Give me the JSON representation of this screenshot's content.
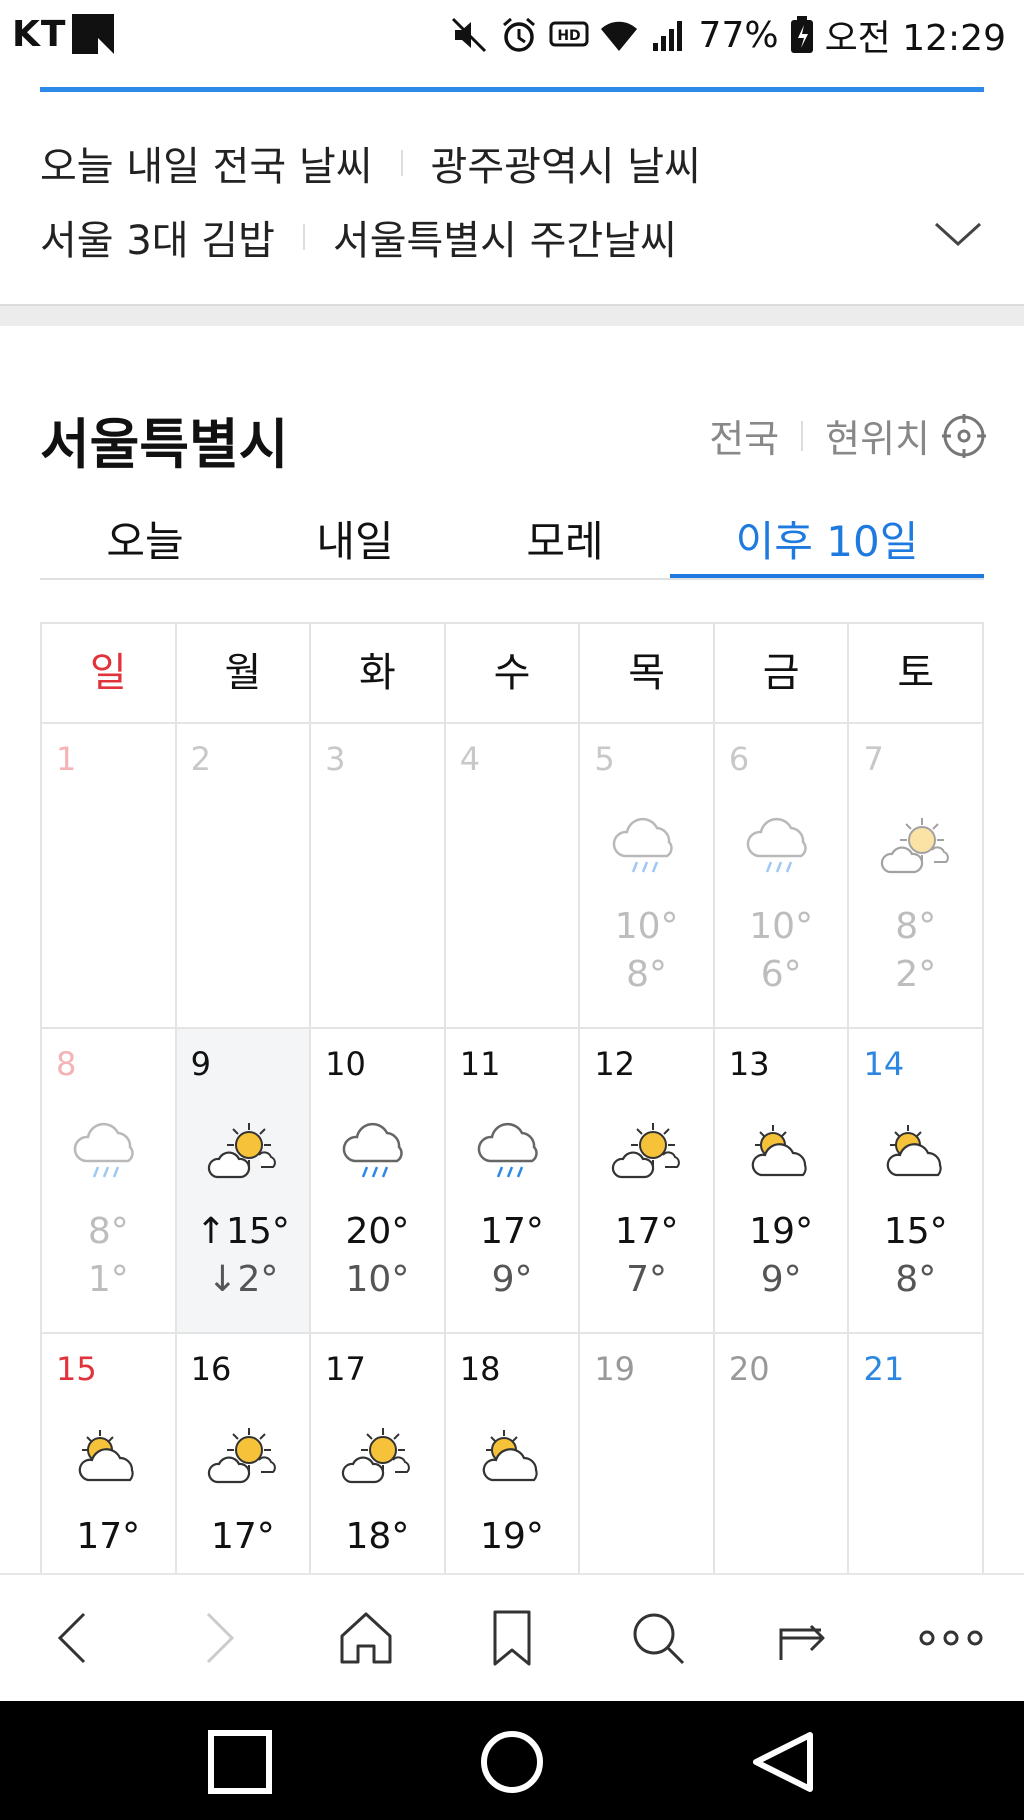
{
  "status_bar": {
    "carrier": "KT",
    "battery": "77%",
    "time": "오전 12:29"
  },
  "related_searches": {
    "row1": [
      "오늘 내일 전국 날씨",
      "광주광역시 날씨"
    ],
    "row2": [
      "서울 3대 김밥",
      "서울특별시 주간날씨"
    ]
  },
  "weather": {
    "city": "서울특별시",
    "links": {
      "nation": "전국",
      "current_location": "현위치"
    },
    "tabs": [
      "오늘",
      "내일",
      "모레",
      "이후 10일"
    ],
    "active_tab": "이후 10일",
    "weekdays": [
      "일",
      "월",
      "화",
      "수",
      "목",
      "금",
      "토"
    ],
    "weeks": [
      [
        {
          "day": "1"
        },
        {
          "day": "2"
        },
        {
          "day": "3"
        },
        {
          "day": "4"
        },
        {
          "day": "5",
          "icon": "rain-cloud-icon",
          "hi": "10°",
          "lo": "8°"
        },
        {
          "day": "6",
          "icon": "rain-cloud-icon",
          "hi": "10°",
          "lo": "6°"
        },
        {
          "day": "7",
          "icon": "sun-behind-cloud-icon",
          "hi": "8°",
          "lo": "2°"
        }
      ],
      [
        {
          "day": "8",
          "icon": "rain-cloud-icon",
          "hi": "8°",
          "lo": "1°"
        },
        {
          "day": "9",
          "icon": "sun-behind-cloud-icon",
          "hi": "↑15°",
          "lo": "↓2°"
        },
        {
          "day": "10",
          "icon": "rain-cloud-icon",
          "hi": "20°",
          "lo": "10°"
        },
        {
          "day": "11",
          "icon": "rain-cloud-icon",
          "hi": "17°",
          "lo": "9°"
        },
        {
          "day": "12",
          "icon": "sun-behind-cloud-icon",
          "hi": "17°",
          "lo": "7°"
        },
        {
          "day": "13",
          "icon": "partly-cloudy-icon",
          "hi": "19°",
          "lo": "9°"
        },
        {
          "day": "14",
          "icon": "partly-cloudy-icon",
          "hi": "15°",
          "lo": "8°"
        }
      ],
      [
        {
          "day": "15",
          "icon": "partly-cloudy-icon",
          "hi": "17°",
          "lo": ""
        },
        {
          "day": "16",
          "icon": "sun-behind-cloud-icon",
          "hi": "17°",
          "lo": ""
        },
        {
          "day": "17",
          "icon": "sun-behind-cloud-icon",
          "hi": "18°",
          "lo": ""
        },
        {
          "day": "18",
          "icon": "partly-cloudy-icon",
          "hi": "19°",
          "lo": ""
        },
        {
          "day": "19"
        },
        {
          "day": "20"
        },
        {
          "day": "21"
        }
      ]
    ],
    "today_day": "9"
  },
  "colors": {
    "accent": "#1f7ae0",
    "sunday": "#e0333b",
    "saturday": "#2d86df"
  }
}
